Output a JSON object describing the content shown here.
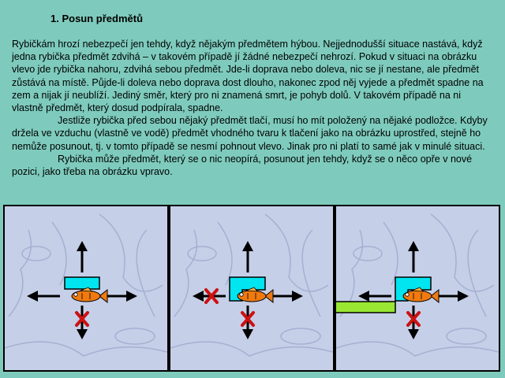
{
  "heading": "1. Posun předmětů",
  "paragraphs": [
    "Rybičkám hrozí nebezpečí jen tehdy, když nějakým předmětem hýbou. Nejjednodušší situace nastává, když jedna rybička předmět zdvihá – v takovém případě jí žádné nebezpečí nehrozí. Pokud v situaci na obrázku vlevo jde rybička nahoru, zdvihá sebou předmět. Jde-li doprava nebo doleva, nic se jí nestane, ale předmět zůstává na místě. Půjde-li doleva nebo doprava dost dlouho, nakonec zpod něj vyjede a předmět spadne na zem a nijak jí neublíží. Jediný směr, který pro ni znamená smrt, je pohyb dolů. V takovém případě na ni vlastně předmět, který dosud podpírala, spadne.",
    "Jestliže rybička před sebou nějaký předmět tlačí, musí ho mít položený na nějaké podložce. Kdyby držela ve vzduchu (vlastně ve vodě) předmět vhodného tvaru k tlačení jako na obrázku uprostřed, stejně ho nemůže posunout, tj. v tomto případě se nesmí pohnout vlevo. Jinak pro ni platí to samé jak v minulé situaci.",
    "Rybička může předmět, který se o nic neopírá, posunout jen tehdy, když se o něco opře v nové pozici, jako třeba na obrázku vpravo."
  ],
  "colors": {
    "background": "#7ecbbd",
    "panel_bg": "#c6cfe8",
    "object": "#00e5f0",
    "support": "#99e633",
    "cross": "#cc1111",
    "fish": "#f07a10"
  },
  "panels": [
    {
      "name": "left",
      "object": "flat-bar",
      "blocked": [
        "down"
      ],
      "support": false
    },
    {
      "name": "middle",
      "object": "l-shape",
      "blocked": [
        "left",
        "down"
      ],
      "support": false
    },
    {
      "name": "right",
      "object": "l-shape",
      "blocked": [
        "down"
      ],
      "support": true
    }
  ]
}
